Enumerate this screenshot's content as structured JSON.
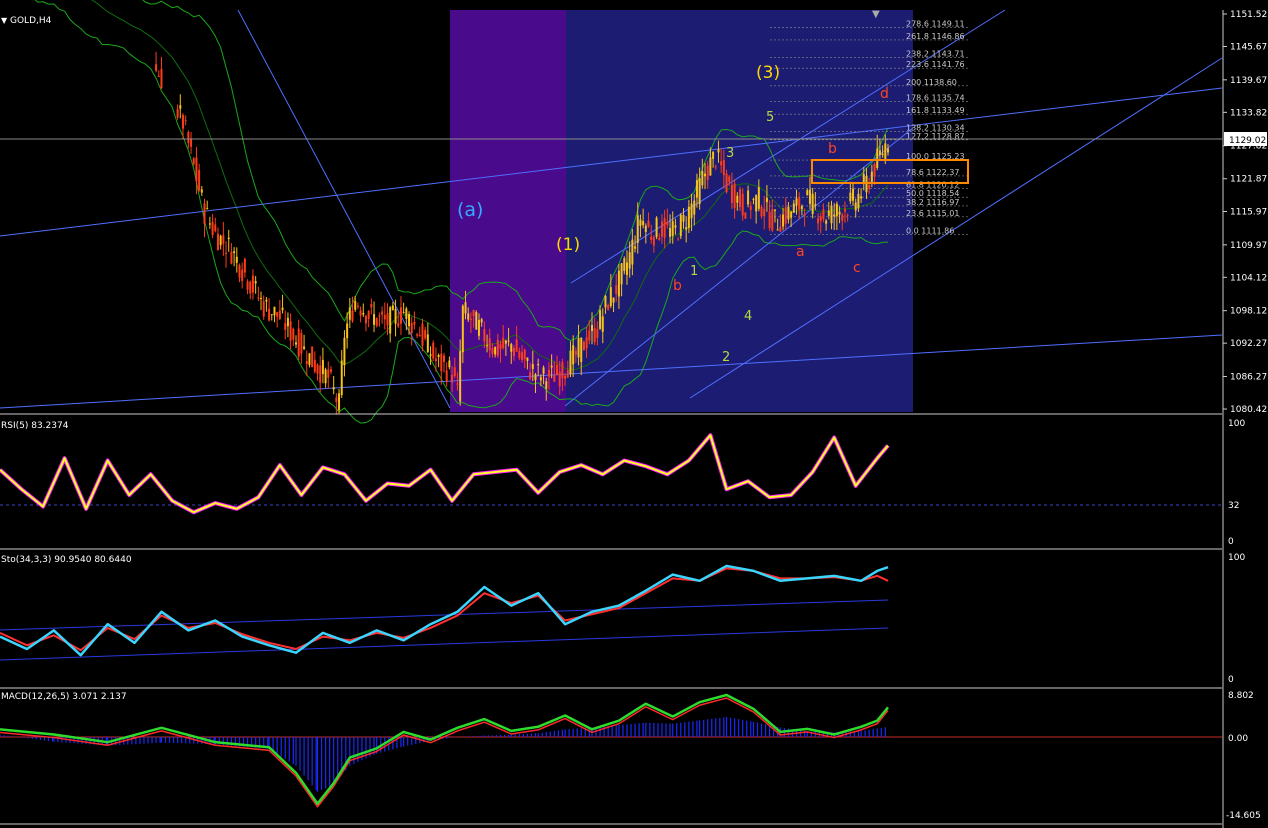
{
  "symbol": "GOLD,H4",
  "colors": {
    "background": "#000000",
    "zone_purple": "#4a0a8c",
    "zone_blue": "#1c1c73",
    "bull_candle": "#f7c21a",
    "bear_candle": "#ff3c1a",
    "trendline": "#4f6fff",
    "bollinger": "#1aa81a",
    "grid_label": "#ffffff",
    "fib": "#c8c8c8",
    "orange_box": "#ff8a00"
  },
  "price_axis": {
    "current_price": "1129.02",
    "ticks": [
      "1151.52",
      "1145.67",
      "1139.67",
      "1133.82",
      "1127.82",
      "1121.87",
      "1115.97",
      "1109.97",
      "1104.12",
      "1098.12",
      "1092.27",
      "1086.27",
      "1080.42"
    ]
  },
  "wave_labels": [
    {
      "text": "(a)",
      "color": "#33aaff"
    },
    {
      "text": "(1)",
      "color": "#ffd700"
    },
    {
      "text": "(3)",
      "color": "#ffd700"
    },
    {
      "text": "5",
      "color": "#b8d840"
    },
    {
      "text": "3",
      "color": "#b8d840"
    },
    {
      "text": "1",
      "color": "#b8d840"
    },
    {
      "text": "4",
      "color": "#b8d840"
    },
    {
      "text": "2",
      "color": "#b8d840"
    },
    {
      "text": "b",
      "color": "#ff4422"
    },
    {
      "text": "b",
      "color": "#ff4422"
    },
    {
      "text": "a",
      "color": "#ff4422"
    },
    {
      "text": "c",
      "color": "#ff4422"
    },
    {
      "text": "d",
      "color": "#ff4422"
    }
  ],
  "fib_levels": [
    {
      "ratio": "278.6",
      "price": "1149.11"
    },
    {
      "ratio": "261.8",
      "price": "1146.86"
    },
    {
      "ratio": "238.2",
      "price": "1143.71"
    },
    {
      "ratio": "223.6",
      "price": "1141.76"
    },
    {
      "ratio": "200",
      "price": "1138.60"
    },
    {
      "ratio": "178.6",
      "price": "1135.74"
    },
    {
      "ratio": "161.8",
      "price": "1133.49"
    },
    {
      "ratio": "138.2",
      "price": "1130.34"
    },
    {
      "ratio": "127.2",
      "price": "1128.87"
    },
    {
      "ratio": "100.0",
      "price": "1125.23"
    },
    {
      "ratio": "78.6",
      "price": "1122.37"
    },
    {
      "ratio": "61.8",
      "price": "1120.12"
    },
    {
      "ratio": "50.0",
      "price": "1118.54"
    },
    {
      "ratio": "38.2",
      "price": "1116.97"
    },
    {
      "ratio": "23.6",
      "price": "1115.01"
    },
    {
      "ratio": "0.0",
      "price": "1111.86"
    }
  ],
  "indicators": {
    "rsi": {
      "label": "RSI(5) 83.2374",
      "ticks": [
        "100",
        "32",
        "0"
      ]
    },
    "stoch": {
      "label": "Sto(34,3,3) 90.9540 80.6440",
      "ticks": [
        "100",
        "0"
      ]
    },
    "macd": {
      "label": "MACD(12,26,5) 3.071 2.137",
      "ticks": [
        "8.802",
        "0.00",
        "-14.605"
      ]
    }
  },
  "chart_data": {
    "type": "candlestick",
    "title": "GOLD,H4",
    "ylim": [
      1080.42,
      1151.52
    ],
    "close_path": [
      [
        0,
        1160
      ],
      [
        18,
        1157
      ],
      [
        30,
        1152
      ],
      [
        42,
        1149
      ],
      [
        52,
        1146
      ],
      [
        60,
        1140
      ],
      [
        68,
        1132
      ],
      [
        72,
        1124
      ],
      [
        76,
        1116
      ],
      [
        80,
        1112
      ],
      [
        86,
        1109
      ],
      [
        92,
        1104
      ],
      [
        98,
        1099
      ],
      [
        104,
        1097
      ],
      [
        110,
        1093
      ],
      [
        116,
        1089
      ],
      [
        122,
        1086
      ],
      [
        126,
        1081
      ],
      [
        128,
        1094
      ],
      [
        132,
        1100
      ],
      [
        138,
        1097
      ],
      [
        144,
        1096
      ],
      [
        150,
        1098
      ],
      [
        156,
        1094
      ],
      [
        162,
        1089
      ],
      [
        168,
        1087
      ],
      [
        170,
        1083
      ],
      [
        172,
        1098
      ],
      [
        178,
        1095
      ],
      [
        184,
        1091
      ],
      [
        190,
        1092
      ],
      [
        196,
        1088
      ],
      [
        202,
        1086
      ],
      [
        208,
        1087
      ],
      [
        214,
        1090
      ],
      [
        218,
        1093
      ],
      [
        222,
        1095
      ],
      [
        226,
        1100
      ],
      [
        230,
        1103
      ],
      [
        234,
        1108
      ],
      [
        238,
        1115
      ],
      [
        242,
        1112
      ],
      [
        246,
        1113
      ],
      [
        250,
        1112
      ],
      [
        254,
        1114
      ],
      [
        258,
        1118
      ],
      [
        262,
        1123
      ],
      [
        266,
        1126
      ],
      [
        270,
        1121
      ],
      [
        276,
        1117
      ],
      [
        282,
        1118
      ],
      [
        288,
        1114
      ],
      [
        294,
        1116
      ],
      [
        300,
        1118
      ],
      [
        306,
        1115
      ],
      [
        312,
        1116
      ],
      [
        318,
        1118
      ],
      [
        322,
        1121
      ],
      [
        326,
        1125
      ],
      [
        330,
        1129
      ]
    ],
    "rsi_path": [
      [
        0,
        62
      ],
      [
        8,
        45
      ],
      [
        16,
        30
      ],
      [
        24,
        72
      ],
      [
        32,
        28
      ],
      [
        40,
        70
      ],
      [
        48,
        40
      ],
      [
        56,
        58
      ],
      [
        64,
        35
      ],
      [
        72,
        25
      ],
      [
        80,
        33
      ],
      [
        88,
        28
      ],
      [
        96,
        38
      ],
      [
        104,
        66
      ],
      [
        112,
        40
      ],
      [
        120,
        64
      ],
      [
        128,
        58
      ],
      [
        136,
        35
      ],
      [
        144,
        50
      ],
      [
        152,
        48
      ],
      [
        160,
        62
      ],
      [
        168,
        35
      ],
      [
        176,
        58
      ],
      [
        184,
        60
      ],
      [
        192,
        62
      ],
      [
        200,
        42
      ],
      [
        208,
        60
      ],
      [
        216,
        66
      ],
      [
        224,
        58
      ],
      [
        232,
        70
      ],
      [
        240,
        65
      ],
      [
        248,
        58
      ],
      [
        256,
        70
      ],
      [
        264,
        92
      ],
      [
        270,
        45
      ],
      [
        278,
        52
      ],
      [
        286,
        38
      ],
      [
        294,
        40
      ],
      [
        302,
        60
      ],
      [
        310,
        90
      ],
      [
        318,
        48
      ],
      [
        326,
        72
      ],
      [
        330,
        83
      ]
    ],
    "stoch_main": [
      [
        0,
        35
      ],
      [
        10,
        25
      ],
      [
        20,
        40
      ],
      [
        30,
        20
      ],
      [
        40,
        45
      ],
      [
        50,
        30
      ],
      [
        60,
        55
      ],
      [
        70,
        40
      ],
      [
        80,
        48
      ],
      [
        90,
        35
      ],
      [
        100,
        28
      ],
      [
        110,
        22
      ],
      [
        120,
        38
      ],
      [
        130,
        30
      ],
      [
        140,
        40
      ],
      [
        150,
        32
      ],
      [
        160,
        45
      ],
      [
        170,
        55
      ],
      [
        180,
        75
      ],
      [
        190,
        60
      ],
      [
        200,
        70
      ],
      [
        210,
        45
      ],
      [
        220,
        55
      ],
      [
        230,
        60
      ],
      [
        240,
        72
      ],
      [
        250,
        85
      ],
      [
        260,
        80
      ],
      [
        270,
        92
      ],
      [
        280,
        88
      ],
      [
        290,
        80
      ],
      [
        300,
        82
      ],
      [
        310,
        84
      ],
      [
        320,
        80
      ],
      [
        326,
        88
      ],
      [
        330,
        91
      ]
    ],
    "stoch_signal": [
      [
        0,
        38
      ],
      [
        10,
        28
      ],
      [
        20,
        36
      ],
      [
        30,
        24
      ],
      [
        40,
        42
      ],
      [
        50,
        33
      ],
      [
        60,
        52
      ],
      [
        70,
        42
      ],
      [
        80,
        46
      ],
      [
        90,
        37
      ],
      [
        100,
        30
      ],
      [
        110,
        25
      ],
      [
        120,
        35
      ],
      [
        130,
        32
      ],
      [
        140,
        38
      ],
      [
        150,
        34
      ],
      [
        160,
        42
      ],
      [
        170,
        52
      ],
      [
        180,
        70
      ],
      [
        190,
        62
      ],
      [
        200,
        68
      ],
      [
        210,
        48
      ],
      [
        220,
        53
      ],
      [
        230,
        58
      ],
      [
        240,
        70
      ],
      [
        250,
        82
      ],
      [
        260,
        80
      ],
      [
        270,
        90
      ],
      [
        280,
        88
      ],
      [
        290,
        82
      ],
      [
        300,
        82
      ],
      [
        310,
        83
      ],
      [
        320,
        80
      ],
      [
        326,
        84
      ],
      [
        330,
        80
      ]
    ],
    "macd_hist": [
      [
        0,
        0.5
      ],
      [
        20,
        -1.0
      ],
      [
        40,
        -1.8
      ],
      [
        60,
        -1.2
      ],
      [
        80,
        -1.5
      ],
      [
        100,
        -2.5
      ],
      [
        110,
        -6
      ],
      [
        118,
        -11.5
      ],
      [
        124,
        -10
      ],
      [
        130,
        -6
      ],
      [
        140,
        -3.5
      ],
      [
        150,
        -2.0
      ],
      [
        160,
        -0.8
      ],
      [
        170,
        0.0
      ],
      [
        180,
        0.3
      ],
      [
        190,
        0.5
      ],
      [
        200,
        0.8
      ],
      [
        210,
        1.6
      ],
      [
        220,
        2.0
      ],
      [
        230,
        2.5
      ],
      [
        240,
        3.0
      ],
      [
        250,
        2.8
      ],
      [
        260,
        3.5
      ],
      [
        270,
        4.2
      ],
      [
        280,
        3.2
      ],
      [
        290,
        2.0
      ],
      [
        300,
        1.2
      ],
      [
        310,
        1.0
      ],
      [
        320,
        1.3
      ],
      [
        326,
        1.8
      ],
      [
        330,
        2.1
      ]
    ],
    "macd_line": [
      [
        0,
        1.5
      ],
      [
        20,
        0.5
      ],
      [
        40,
        -1.0
      ],
      [
        60,
        1.8
      ],
      [
        80,
        -1.0
      ],
      [
        100,
        -2.0
      ],
      [
        110,
        -7
      ],
      [
        118,
        -13
      ],
      [
        124,
        -9
      ],
      [
        130,
        -4
      ],
      [
        140,
        -2.2
      ],
      [
        150,
        1.0
      ],
      [
        160,
        -0.5
      ],
      [
        170,
        1.8
      ],
      [
        180,
        3.5
      ],
      [
        190,
        1.2
      ],
      [
        200,
        2.0
      ],
      [
        210,
        4.2
      ],
      [
        220,
        1.5
      ],
      [
        230,
        3.2
      ],
      [
        240,
        6.5
      ],
      [
        250,
        4.0
      ],
      [
        260,
        6.8
      ],
      [
        270,
        8.2
      ],
      [
        280,
        5.5
      ],
      [
        290,
        1.0
      ],
      [
        300,
        1.6
      ],
      [
        310,
        0.5
      ],
      [
        320,
        2.0
      ],
      [
        326,
        3.2
      ],
      [
        330,
        5.8
      ]
    ]
  }
}
